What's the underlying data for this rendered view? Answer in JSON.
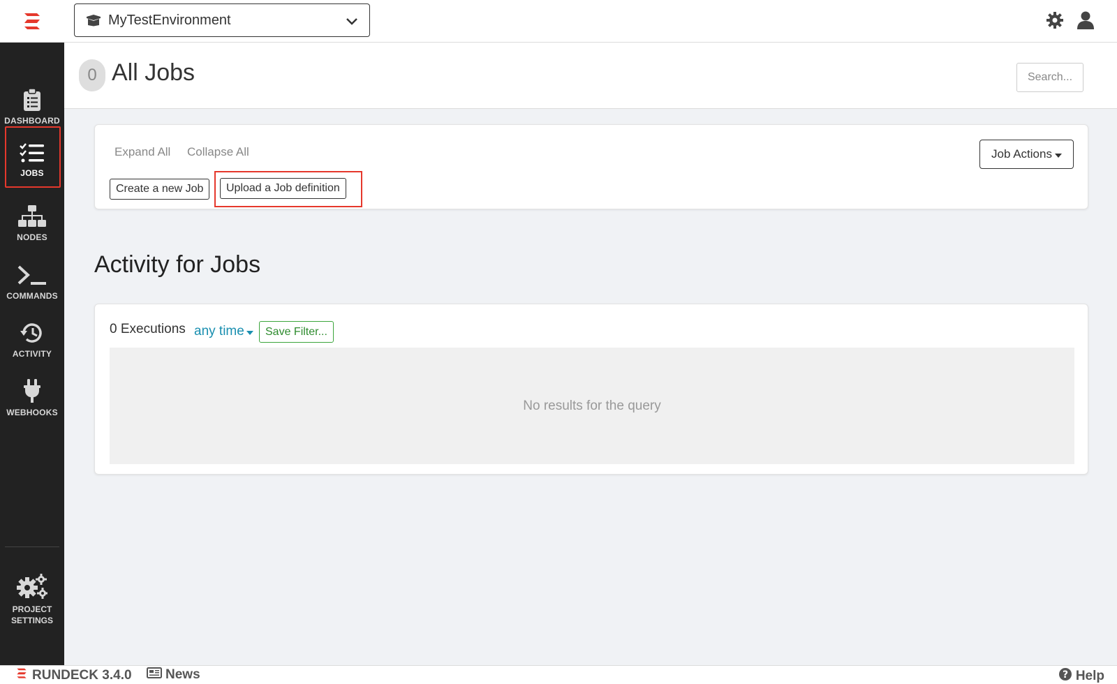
{
  "app": {
    "brand_color": "#e5382c",
    "accent_link_color": "#1a8fb0",
    "success_color": "#3ba53b"
  },
  "topbar": {
    "logo_icon": "rundeck-logo-icon",
    "project_name": "MyTestEnvironment",
    "project_icon": "box-icon",
    "settings_icon": "gear-icon",
    "user_icon": "user-icon"
  },
  "sidebar": {
    "items": [
      {
        "label": "DASHBOARD",
        "icon": "clipboard-icon"
      },
      {
        "label": "JOBS",
        "icon": "tasks-icon",
        "active": true
      },
      {
        "label": "NODES",
        "icon": "sitemap-icon"
      },
      {
        "label": "COMMANDS",
        "icon": "terminal-icon"
      },
      {
        "label": "ACTIVITY",
        "icon": "history-icon"
      },
      {
        "label": "WEBHOOKS",
        "icon": "plug-icon"
      }
    ],
    "project_settings": {
      "line1": "PROJECT",
      "line2": "SETTINGS",
      "icon": "gears-icon"
    }
  },
  "header": {
    "job_count": "0",
    "title": "All Jobs",
    "search_label": "Search..."
  },
  "jobs_card": {
    "expand_all": "Expand All",
    "collapse_all": "Collapse All",
    "create_job": "Create a new Job",
    "upload_job": "Upload a Job definition",
    "job_actions": "Job Actions"
  },
  "activity": {
    "title": "Activity for Jobs",
    "executions": "0 Executions",
    "time_filter": "any time",
    "save_filter": "Save Filter...",
    "empty_message": "No results for the query"
  },
  "footer": {
    "brand": "RUNDECK 3.4.0",
    "news": "News",
    "help": "Help"
  }
}
